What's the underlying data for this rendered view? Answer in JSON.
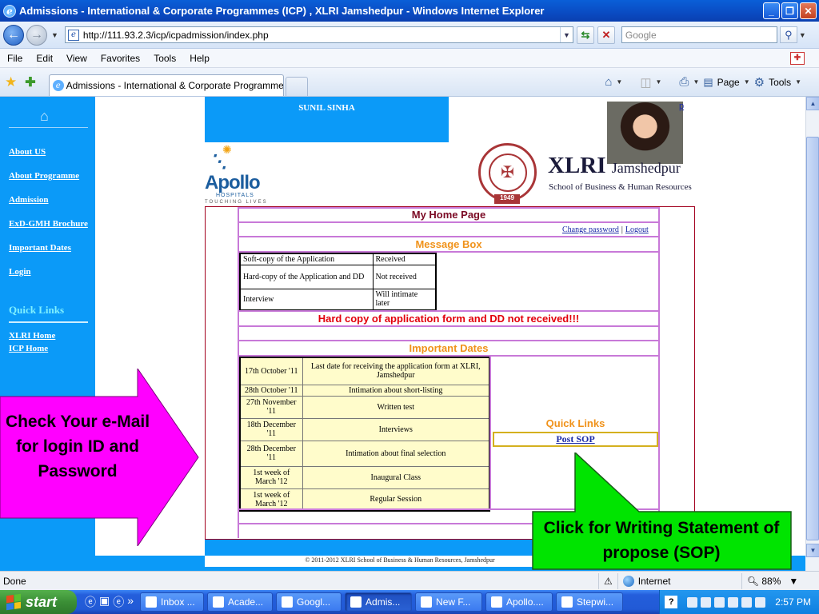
{
  "window": {
    "title": "Admissions - International & Corporate Programmes (ICP) , XLRI Jamshedpur - Windows Internet Explorer"
  },
  "browser": {
    "url": "http://111.93.2.3/icp/icpadmission/index.php",
    "search_placeholder": "Google",
    "menu": [
      "File",
      "Edit",
      "View",
      "Favorites",
      "Tools",
      "Help"
    ],
    "tab_title": "Admissions - International & Corporate Programmes (I...",
    "commands": {
      "page": "Page",
      "tools": "Tools"
    },
    "status": {
      "text": "Done",
      "zone": "Internet",
      "zoom": "88%"
    }
  },
  "page": {
    "header_name": "SUNIL SINHA",
    "photo_link": "p",
    "apollo": {
      "word": "Apollo",
      "sub": "HOSPITALS",
      "tag": "TOUCHING LIVES"
    },
    "xlri": {
      "name": "XLRI",
      "city": "Jamshedpur",
      "subtitle": "School of Business & Human Resources",
      "year": "1949"
    },
    "sidebar": {
      "links": [
        "About US",
        "About Programme",
        "Admission",
        "ExD-GMH Brochure",
        "Important Dates",
        "Login"
      ],
      "quick_links_title": "Quick Links",
      "quick_links": [
        "XLRI Home",
        "ICP Home"
      ]
    },
    "home_title": "My Home Page",
    "change_password": "Change password",
    "link_sep": "|",
    "logout": "Logout",
    "message_box_title": "Message Box",
    "messages": [
      {
        "item": "Soft-copy  of the Application",
        "status": "Received"
      },
      {
        "item": "Hard-copy  of the Application and DD",
        "status": "Not received"
      },
      {
        "item": "Interview",
        "status": "Will intimate later"
      }
    ],
    "warning": "Hard copy of application form and DD not received!!!",
    "dates_title": "Important Dates",
    "dates": [
      {
        "date": "17th October '11",
        "event": "Last date for receiving the application form at XLRI, Jamshedpur"
      },
      {
        "date": "28th October '11",
        "event": "Intimation about short-listing"
      },
      {
        "date": "27th November '11",
        "event": "Written test"
      },
      {
        "date": "18th December '11",
        "event": "Interviews"
      },
      {
        "date": "28th December '11",
        "event": "Intimation about final selection"
      },
      {
        "date": "1st week of March '12",
        "event": "Inaugural Class"
      },
      {
        "date": "1st week of March '12",
        "event": "Regular Session"
      }
    ],
    "quick_links_mid": "Quick Links",
    "post_sop": "Post SOP",
    "copyright": "© 2011-2012 XLRI School of Business & Human Resources, Jamshedpur"
  },
  "callouts": {
    "left": "Check Your e-Mail for login ID and Password",
    "right": "Click for Writing Statement of propose (SOP)",
    "left_color": "#ff00ff",
    "right_color": "#00e400"
  },
  "taskbar": {
    "start": "start",
    "buttons": [
      "Inbox ...",
      "Acade...",
      "Googl...",
      "Admis...",
      "New F...",
      "Apollo....",
      "Stepwi..."
    ],
    "active_index": 3,
    "clock": "2:57 PM"
  }
}
